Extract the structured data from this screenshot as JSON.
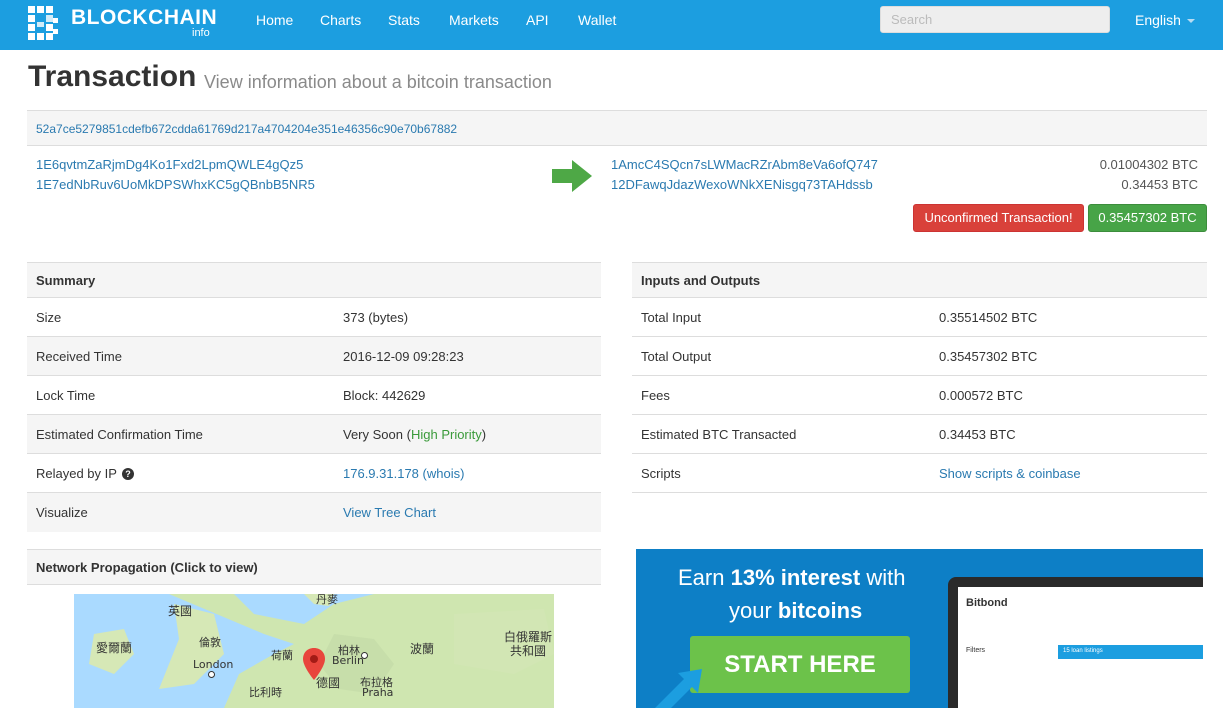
{
  "nav": {
    "logo_text": "BLOCKCHAIN",
    "logo_sub": "info",
    "links": [
      "Home",
      "Charts",
      "Stats",
      "Markets",
      "API",
      "Wallet"
    ],
    "search_placeholder": "Search",
    "language": "English"
  },
  "page": {
    "title": "Transaction",
    "subtitle": "View information about a bitcoin transaction"
  },
  "tx": {
    "hash": "52a7ce5279851cdefb672cdda61769d217a4704204e351e46356c90e70b67882",
    "inputs": [
      "1E6qvtmZaRjmDg4Ko1Fxd2LpmQWLE4gQz5",
      "1E7edNbRuv6UoMkDPSWhxKC5gQBnbB5NR5"
    ],
    "outputs": [
      {
        "address": "1AmcC4SQcn7sLWMacRZrAbm8eVa6ofQ747",
        "amount": "0.01004302 BTC"
      },
      {
        "address": "12DFawqJdazWexoWNkXENisgq73TAHdssb",
        "amount": "0.34453 BTC"
      }
    ],
    "status_label": "Unconfirmed Transaction!",
    "total_label": "0.35457302 BTC"
  },
  "summary": {
    "heading": "Summary",
    "size_label": "Size",
    "size_value": "373 (bytes)",
    "received_label": "Received Time",
    "received_value": "2016-12-09 09:28:23",
    "lock_label": "Lock Time",
    "lock_value": "Block: 442629",
    "conf_label": "Estimated Confirmation Time",
    "conf_value": "Very Soon",
    "conf_open": "(",
    "conf_priority": "High Priority",
    "conf_close": ")",
    "relayed_label": "Relayed by IP",
    "relayed_help": "?",
    "relayed_ip": "176.9.31.178",
    "relayed_whois": "(whois)",
    "visualize_label": "Visualize",
    "visualize_link": "View Tree Chart"
  },
  "io": {
    "heading": "Inputs and Outputs",
    "total_input_label": "Total Input",
    "total_input_value": "0.35514502 BTC",
    "total_output_label": "Total Output",
    "total_output_value": "0.35457302 BTC",
    "fees_label": "Fees",
    "fees_value": "0.000572 BTC",
    "est_label": "Estimated BTC Transacted",
    "est_value": "0.34453 BTC",
    "scripts_label": "Scripts",
    "scripts_link": "Show scripts & coinbase"
  },
  "network": {
    "heading": "Network Propagation (Click to view)",
    "map_labels": [
      "英國",
      "丹麥",
      "愛爾蘭",
      "倫敦",
      "London",
      "荷蘭",
      "柏林",
      "Berlin",
      "波蘭",
      "白俄羅斯",
      "共和國",
      "比利時",
      "德國",
      "布拉格",
      "Praha"
    ]
  },
  "ad": {
    "line1_a": "Earn ",
    "line1_b": "13% interest",
    "line1_c": " with",
    "line2_a": "your ",
    "line2_b": "bitcoins",
    "button": "START HERE",
    "brand": "Bitbond",
    "listing": "15 loan listings",
    "filters": "Filters"
  },
  "colors": {
    "nav_bg": "#1c9ee0",
    "link": "#2a7ab0",
    "danger": "#d9413a",
    "success": "#47a447",
    "ad_bg": "#0d7fc6",
    "ad_button": "#6cc24a"
  }
}
